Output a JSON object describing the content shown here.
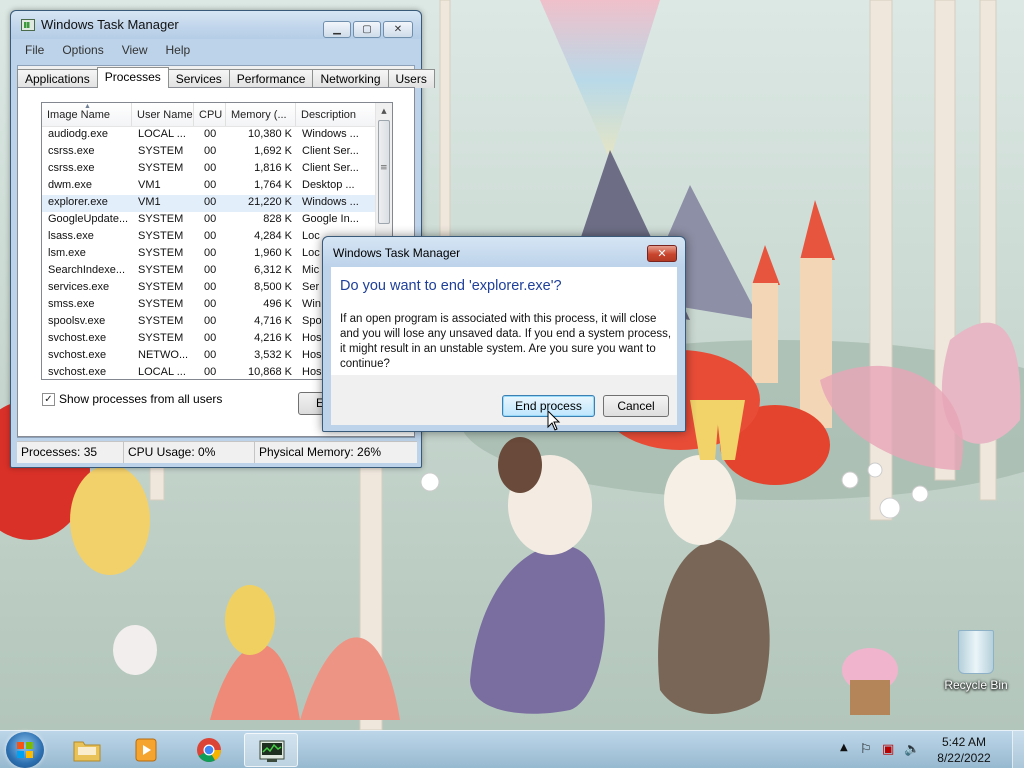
{
  "desktop": {
    "icons": [
      {
        "label": "Recycle Bin",
        "icon": "recycle-bin-icon"
      }
    ]
  },
  "task_manager": {
    "title": "Windows Task Manager",
    "menu": [
      "File",
      "Options",
      "View",
      "Help"
    ],
    "tabs": [
      "Applications",
      "Processes",
      "Services",
      "Performance",
      "Networking",
      "Users"
    ],
    "active_tab": "Processes",
    "columns": [
      "Image Name",
      "User Name",
      "CPU",
      "Memory (...",
      "Description"
    ],
    "processes": [
      {
        "image": "audiodg.exe",
        "user": "LOCAL ...",
        "cpu": "00",
        "memory": "10,380 K",
        "description": "Windows ..."
      },
      {
        "image": "csrss.exe",
        "user": "SYSTEM",
        "cpu": "00",
        "memory": "1,692 K",
        "description": "Client Ser..."
      },
      {
        "image": "csrss.exe",
        "user": "SYSTEM",
        "cpu": "00",
        "memory": "1,816 K",
        "description": "Client Ser..."
      },
      {
        "image": "dwm.exe",
        "user": "VM1",
        "cpu": "00",
        "memory": "1,764 K",
        "description": "Desktop ..."
      },
      {
        "image": "explorer.exe",
        "user": "VM1",
        "cpu": "00",
        "memory": "21,220 K",
        "description": "Windows ..."
      },
      {
        "image": "GoogleUpdate...",
        "user": "SYSTEM",
        "cpu": "00",
        "memory": "828 K",
        "description": "Google In..."
      },
      {
        "image": "lsass.exe",
        "user": "SYSTEM",
        "cpu": "00",
        "memory": "4,284 K",
        "description": "Loc"
      },
      {
        "image": "lsm.exe",
        "user": "SYSTEM",
        "cpu": "00",
        "memory": "1,960 K",
        "description": "Loc"
      },
      {
        "image": "SearchIndexe...",
        "user": "SYSTEM",
        "cpu": "00",
        "memory": "6,312 K",
        "description": "Mic"
      },
      {
        "image": "services.exe",
        "user": "SYSTEM",
        "cpu": "00",
        "memory": "8,500 K",
        "description": "Ser"
      },
      {
        "image": "smss.exe",
        "user": "SYSTEM",
        "cpu": "00",
        "memory": "496 K",
        "description": "Win"
      },
      {
        "image": "spoolsv.exe",
        "user": "SYSTEM",
        "cpu": "00",
        "memory": "4,716 K",
        "description": "Spo"
      },
      {
        "image": "svchost.exe",
        "user": "SYSTEM",
        "cpu": "00",
        "memory": "4,216 K",
        "description": "Hos"
      },
      {
        "image": "svchost.exe",
        "user": "NETWO...",
        "cpu": "00",
        "memory": "3,532 K",
        "description": "Hos"
      },
      {
        "image": "svchost.exe",
        "user": "LOCAL ...",
        "cpu": "00",
        "memory": "10,868 K",
        "description": "Hos"
      }
    ],
    "selected_process": "explorer.exe",
    "show_all_label": "Show processes from all users",
    "show_all_checked": true,
    "end_process_partial": "E",
    "status": {
      "processes": "Processes: 35",
      "cpu": "CPU Usage: 0%",
      "memory": "Physical Memory: 26%"
    }
  },
  "dialog": {
    "title": "Windows Task Manager",
    "heading": "Do you want to end 'explorer.exe'?",
    "message": "If an open program is associated with this process, it will close and you will lose any unsaved data. If you end a system process, it might result in an unstable system. Are you sure you want to continue?",
    "primary_button": "End process",
    "cancel_button": "Cancel"
  },
  "taskbar": {
    "pinned": [
      {
        "name": "start-button",
        "icon": "windows-logo-icon"
      },
      {
        "name": "explorer",
        "icon": "folder-icon"
      },
      {
        "name": "media-player",
        "icon": "media-player-icon"
      },
      {
        "name": "chrome",
        "icon": "chrome-icon"
      },
      {
        "name": "task-manager",
        "icon": "task-manager-icon",
        "active": true
      }
    ],
    "clock": {
      "time": "5:42 AM",
      "date": "8/22/2022"
    }
  },
  "colors": {
    "dialog_heading": "#1e3f9a",
    "selected_row": "#e3eefb",
    "window_frame": "#bcd3e9",
    "close_button": "#c9452d"
  }
}
